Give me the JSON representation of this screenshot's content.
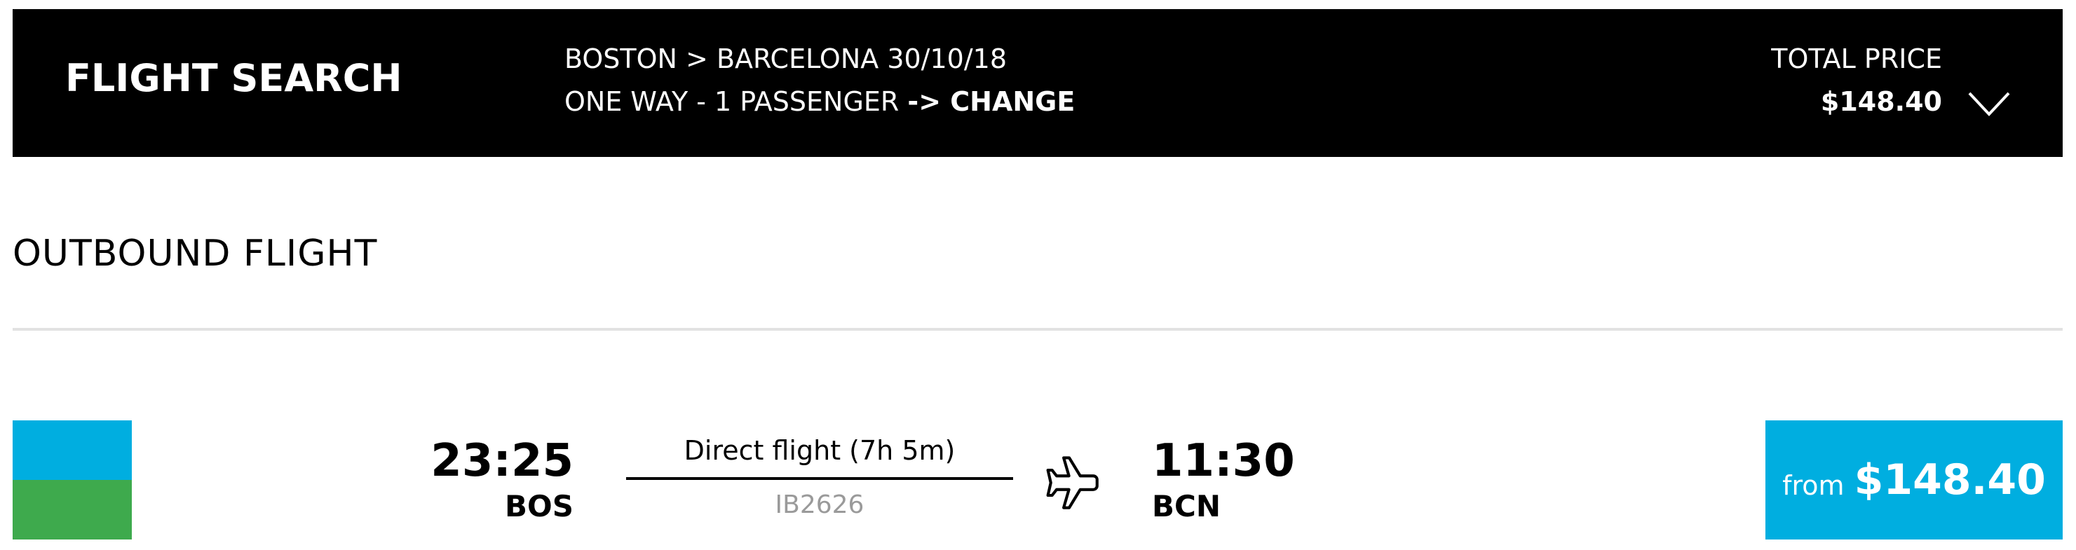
{
  "header": {
    "title": "FLIGHT SEARCH",
    "route": "BOSTON > BARCELONA 30/10/18",
    "trip_details": "ONE WAY - 1 PASSENGER",
    "change_link": "-> CHANGE",
    "total_price_label": "TOTAL PRICE",
    "total_price_value": "$148.40",
    "expand_icon": "chevron-down-icon"
  },
  "section": {
    "title": "OUTBOUND FLIGHT"
  },
  "flight": {
    "airline_logo_colors": {
      "top": "#00aee0",
      "bottom": "#3eaa4d"
    },
    "departure_time": "23:25",
    "departure_code": "BOS",
    "duration": "Direct flight (7h 5m)",
    "flight_number": "IB2626",
    "plane_icon": "airplane-icon",
    "arrival_time": "11:30",
    "arrival_code": "BCN",
    "price_prefix": "from",
    "price": "$148.40"
  },
  "colors": {
    "header_bg": "#000000",
    "accent": "#00aee0",
    "divider": "#e2e2e2",
    "muted_text": "#9a9a9a"
  }
}
